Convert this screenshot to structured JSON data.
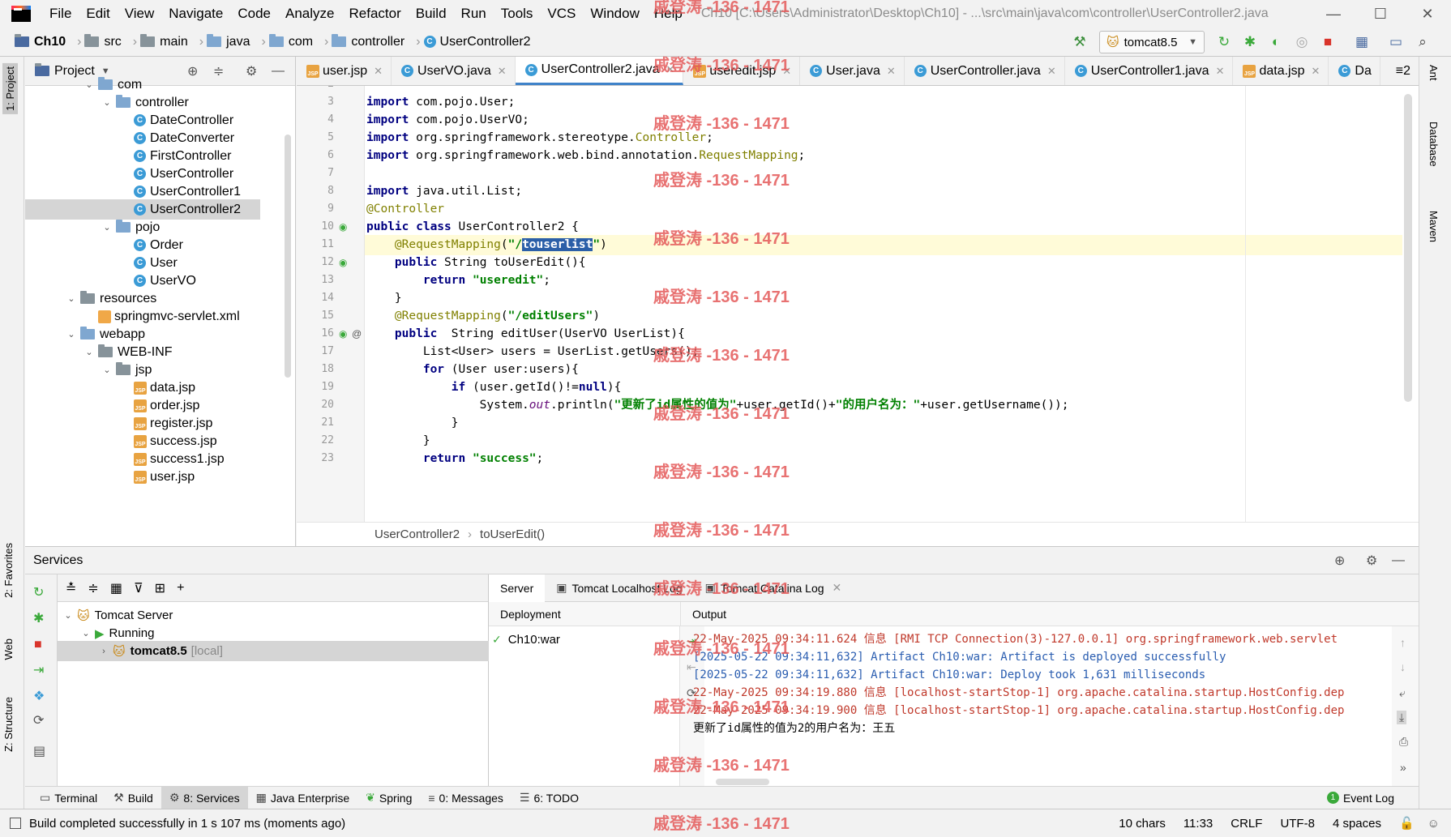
{
  "menu": [
    "File",
    "Edit",
    "View",
    "Navigate",
    "Code",
    "Analyze",
    "Refactor",
    "Build",
    "Run",
    "Tools",
    "VCS",
    "Window",
    "Help"
  ],
  "window_title": "Ch10 [C:\\Users\\Administrator\\Desktop\\Ch10] - ...\\src\\main\\java\\com\\controller\\UserController2.java",
  "breadcrumbs": [
    "Ch10",
    "src",
    "main",
    "java",
    "com",
    "controller",
    "UserController2"
  ],
  "run_config": "tomcat8.5",
  "project_panel": {
    "title": "Project"
  },
  "tree": [
    {
      "label": "com",
      "indent": 2,
      "type": "folder-blue",
      "expanded": true
    },
    {
      "label": "controller",
      "indent": 3,
      "type": "folder-blue",
      "expanded": true
    },
    {
      "label": "DateController",
      "indent": 4,
      "type": "class"
    },
    {
      "label": "DateConverter",
      "indent": 4,
      "type": "class"
    },
    {
      "label": "FirstController",
      "indent": 4,
      "type": "class"
    },
    {
      "label": "UserController",
      "indent": 4,
      "type": "class"
    },
    {
      "label": "UserController1",
      "indent": 4,
      "type": "class"
    },
    {
      "label": "UserController2",
      "indent": 4,
      "type": "class",
      "selected": true
    },
    {
      "label": "pojo",
      "indent": 3,
      "type": "folder-blue",
      "expanded": true
    },
    {
      "label": "Order",
      "indent": 4,
      "type": "class"
    },
    {
      "label": "User",
      "indent": 4,
      "type": "class"
    },
    {
      "label": "UserVO",
      "indent": 4,
      "type": "class"
    },
    {
      "label": "resources",
      "indent": 1,
      "type": "folder",
      "expanded": true
    },
    {
      "label": "springmvc-servlet.xml",
      "indent": 2,
      "type": "xml"
    },
    {
      "label": "webapp",
      "indent": 1,
      "type": "folder-blue",
      "expanded": true
    },
    {
      "label": "WEB-INF",
      "indent": 2,
      "type": "folder",
      "expanded": true
    },
    {
      "label": "jsp",
      "indent": 3,
      "type": "folder",
      "expanded": true
    },
    {
      "label": "data.jsp",
      "indent": 4,
      "type": "jsp"
    },
    {
      "label": "order.jsp",
      "indent": 4,
      "type": "jsp"
    },
    {
      "label": "register.jsp",
      "indent": 4,
      "type": "jsp"
    },
    {
      "label": "success.jsp",
      "indent": 4,
      "type": "jsp"
    },
    {
      "label": "success1.jsp",
      "indent": 4,
      "type": "jsp"
    },
    {
      "label": "user.jsp",
      "indent": 4,
      "type": "jsp"
    }
  ],
  "tabs": [
    {
      "label": "user.jsp",
      "type": "jsp"
    },
    {
      "label": "UserVO.java",
      "type": "class"
    },
    {
      "label": "UserController2.java",
      "type": "class",
      "active": true
    },
    {
      "label": "useredit.jsp",
      "type": "jsp"
    },
    {
      "label": "User.java",
      "type": "class"
    },
    {
      "label": "UserController.java",
      "type": "class"
    },
    {
      "label": "UserController1.java",
      "type": "class"
    },
    {
      "label": "data.jsp",
      "type": "jsp"
    },
    {
      "label": "Da",
      "type": "class"
    }
  ],
  "tab_overflow": "≡2",
  "code_lines": [
    {
      "n": "2",
      "html": ""
    },
    {
      "n": "3",
      "html": "<span class=\"kw\">import</span> com.pojo.User;"
    },
    {
      "n": "4",
      "html": "<span class=\"kw\">import</span> com.pojo.UserVO;"
    },
    {
      "n": "5",
      "html": "<span class=\"kw\">import</span> org.springframework.stereotype.<span class=\"ann\">Controller</span>;"
    },
    {
      "n": "6",
      "html": "<span class=\"kw\">import</span> org.springframework.web.bind.annotation.<span class=\"ann\">RequestMapping</span>;"
    },
    {
      "n": "7",
      "html": ""
    },
    {
      "n": "8",
      "html": "<span class=\"kw\">import</span> java.util.List;"
    },
    {
      "n": "9",
      "html": "<span class=\"ann\">@Controller</span>"
    },
    {
      "n": "10",
      "html": "<span class=\"kw\">public class</span> UserController2 {"
    },
    {
      "n": "11",
      "html": "    <span class=\"ann\">@RequestMapping</span>(<span class=\"str\">\"/<span class=\"hl-sel\">touserlist</span>\"</span>)"
    },
    {
      "n": "12",
      "html": "    <span class=\"kw\">public</span> String toUserEdit(){"
    },
    {
      "n": "13",
      "html": "        <span class=\"kw\">return</span> <span class=\"str\">\"useredit\"</span>;"
    },
    {
      "n": "14",
      "html": "    }"
    },
    {
      "n": "15",
      "html": "    <span class=\"ann\">@RequestMapping</span>(<span class=\"str\">\"/editUsers\"</span>)"
    },
    {
      "n": "16",
      "html": "    <span class=\"kw\">public</span>  String editUser(UserVO UserList){"
    },
    {
      "n": "17",
      "html": "        List&lt;User&gt; users = UserList.getUsers();"
    },
    {
      "n": "18",
      "html": "        <span class=\"kw\">for</span> (User user:users){"
    },
    {
      "n": "19",
      "html": "            <span class=\"kw\">if</span> (user.getId()!=<span class=\"kw\">null</span>){"
    },
    {
      "n": "20",
      "html": "                System.<span class=\"fld\">out</span>.println(<span class=\"str\">\"更新了id属性的值为\"</span>+user.getId()+<span class=\"str\">\"的用户名为：\"</span>+user.getUsername());"
    },
    {
      "n": "21",
      "html": "            }"
    },
    {
      "n": "22",
      "html": "        }"
    },
    {
      "n": "23",
      "html": "        <span class=\"kw\">return</span> <span class=\"str\">\"success\"</span>;"
    }
  ],
  "editor_breadcrumb": [
    "UserController2",
    "toUserEdit()"
  ],
  "services": {
    "title": "Services",
    "tree": [
      {
        "label": "Tomcat Server",
        "indent": 0
      },
      {
        "label": "Running",
        "indent": 1
      },
      {
        "label": "tomcat8.5",
        "suffix": "[local]",
        "indent": 2,
        "selected": true
      }
    ],
    "subtabs": [
      "Server",
      "Tomcat Localhost Log",
      "Tomcat Catalina Log"
    ],
    "deployment_header": "Deployment",
    "output_header": "Output",
    "deployment_item": "Ch10:war",
    "log": [
      {
        "text": "22-May-2025 09:34:11.624 信息 [RMI TCP Connection(3)-127.0.0.1] org.springframework.web.servlet",
        "cls": "logred"
      },
      {
        "text": "[2025-05-22 09:34:11,632] Artifact Ch10:war: Artifact is deployed successfully",
        "cls": "logblue"
      },
      {
        "text": "[2025-05-22 09:34:11,632] Artifact Ch10:war: Deploy took 1,631 milliseconds",
        "cls": "logblue"
      },
      {
        "text": "22-May-2025 09:34:19.880 信息 [localhost-startStop-1] org.apache.catalina.startup.HostConfig.dep",
        "cls": "logred"
      },
      {
        "text": "22-May-2025 09:34:19.900 信息 [localhost-startStop-1] org.apache.catalina.startup.HostConfig.dep",
        "cls": "logred"
      },
      {
        "text": "更新了id属性的值为2的用户名为：王五",
        "cls": ""
      }
    ]
  },
  "bottom_tabs": [
    "Terminal",
    "Build",
    "8: Services",
    "Java Enterprise",
    "Spring",
    "0: Messages",
    "6: TODO"
  ],
  "event_log": "Event Log",
  "left_tabs": [
    "1: Project",
    "2: Favorites",
    "Web",
    "Z: Structure"
  ],
  "right_tabs": [
    "Ant",
    "Database",
    "Maven"
  ],
  "status": {
    "message": "Build completed successfully in 1 s 107 ms (moments ago)",
    "chars": "10 chars",
    "position": "11:33",
    "line_sep": "CRLF",
    "encoding": "UTF-8",
    "indent": "4 spaces"
  },
  "watermark": "戚登涛 -136 - 1471"
}
